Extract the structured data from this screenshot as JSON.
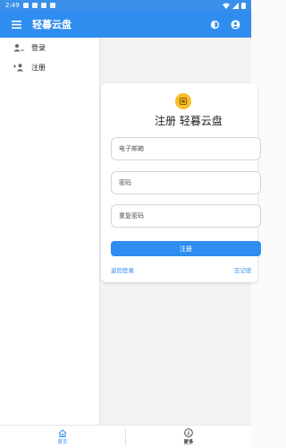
{
  "status_bar": {
    "time": "2:49"
  },
  "app_bar": {
    "title": "轻暮云盘"
  },
  "drawer": {
    "items": [
      {
        "label": "登录"
      },
      {
        "label": "注册"
      }
    ]
  },
  "card": {
    "title": "注册 轻暮云盘",
    "email_placeholder": "电子邮箱",
    "password_placeholder": "密码",
    "confirm_placeholder": "重复密码",
    "submit_label": "注册",
    "back_link": "返回登录",
    "forgot_link": "忘记密"
  },
  "bottom_nav": {
    "items": [
      {
        "label": "首页",
        "active": true
      },
      {
        "label": "更多",
        "active": false
      }
    ]
  },
  "colors": {
    "primary": "#2f8df0",
    "logo": "#f7c02b"
  }
}
